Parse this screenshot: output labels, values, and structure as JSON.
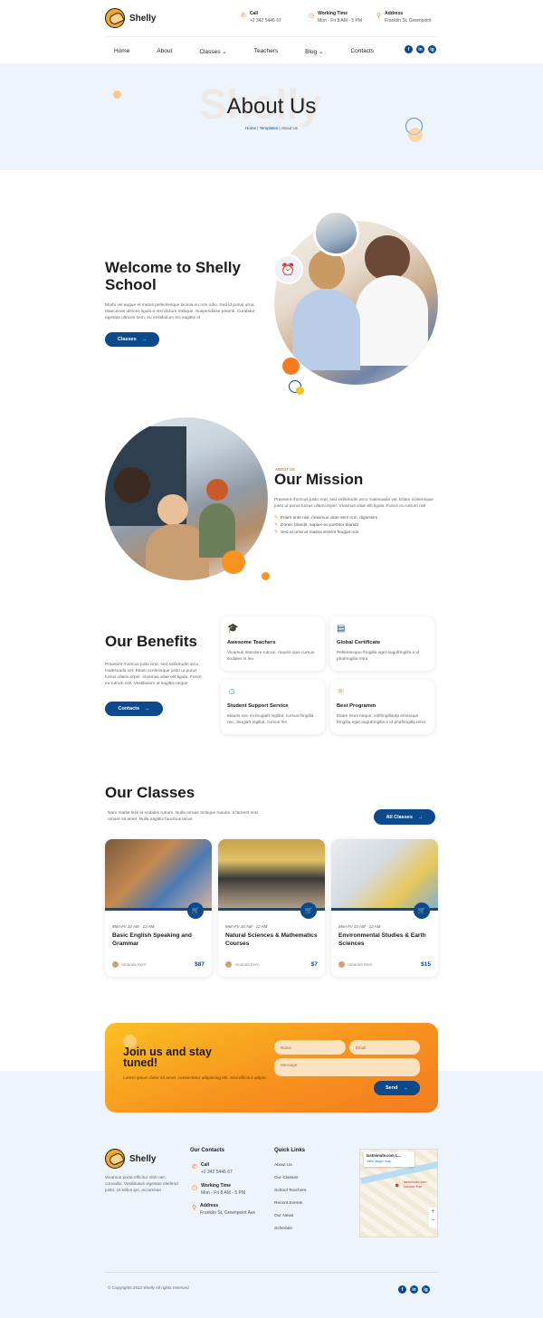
{
  "header": {
    "brand": "Shelly",
    "call_label": "Call",
    "call_value": "+2 342 5446 67",
    "hours_label": "Working Time",
    "hours_value": "Mon - Fri 8 AM - 5 PM",
    "address_label": "Address",
    "address_value": "Franklin St, Greenpoint"
  },
  "nav": {
    "items": [
      "Home",
      "About",
      "Classes",
      "Teachers",
      "Blog",
      "Contacts"
    ],
    "social": [
      "f",
      "in",
      "ig"
    ]
  },
  "hero": {
    "ghost": "Shelly",
    "title": "About Us",
    "crumb_home": "Home",
    "crumb_templates": "Templates",
    "crumb_current": "About Us"
  },
  "welcome": {
    "title": "Welcome to Shelly School",
    "text": "Morbi vel augue et metus pellentesque lacinia eu non odio. Sed id purus urna. Maecenas ultrices ligula a nisl dictum tristique. Suspendisse potenti. Curabitur egestas ultrices sem, eu vestibulum leo sagittis et",
    "button": "Classes"
  },
  "mission": {
    "eyebrow": "ABOUT US",
    "title": "Our Mission",
    "text": "Praesent rhoncus justo erat, sed sollicitudin arcu malesuada vel. Etiam scelerisque justo ut purus luctus ullamcorper. Vivamus vitae elit ligula. Fusce eu rutrum nisl",
    "points": [
      "Etiam ante nisl, maximus vitae sem non, dignissim",
      "Donec blandit, sapien eu porttitor blandit",
      "Sed at urna at massa viverra feugiat non"
    ]
  },
  "benefits": {
    "title": "Our Benefits",
    "text": "Praesent rhoncus justo erat, sed sollicitudin arcu malesuada vel. Etiam scelerisque justo ut purus luctus ullamcorper. Vivamus vitae elit ligula. Fusce eu rutrum nisl. Vestibulum at sagittis neque",
    "button": "Contacts",
    "cards": [
      {
        "title": "Awesome Teachers",
        "text": "Vivamus interdum rutrum, mauris quis cursus sodales is leo",
        "icon": "graduation-cap-icon"
      },
      {
        "title": "Global Certificate",
        "text": "Pellentesque fringilla eget augufringilla e id phafringilla retra",
        "icon": "certificate-icon"
      },
      {
        "title": "Student Support Service",
        "text": "Mauris nec mi feugiafr ingillat, cursus fringilla nec, feugiafr ingillat, cursus frin",
        "icon": "support-icon"
      },
      {
        "title": "Best Programm",
        "text": "Etiam risus neque, volfringillaufp emseque fringilla eget augufringilla e id phafringilla retra",
        "icon": "atom-icon"
      }
    ]
  },
  "classes": {
    "title": "Our Classes",
    "text": "Nam mattis felis id sodales rutrum. Nulla ornare tristique mauris, a laoreet erat ornare sit amet. Nulla sagittis faucibus lacus",
    "button": "All Classes",
    "items": [
      {
        "meta": "Mon-Fri    10 AM - 12 AM",
        "title": "Basic English Speaking and Grammar",
        "teacher": "Amanda Kern",
        "price": "$87"
      },
      {
        "meta": "Mon-Fri    10 AM - 12 AM",
        "title": "Natural Sciences & Mathematics Courses",
        "teacher": "Amanda Kern",
        "price": "$7"
      },
      {
        "meta": "Mon-Fri    10 AM - 12 AM",
        "title": "Environmental Studies & Earth Sciences",
        "teacher": "Amanda Kern",
        "price": "$15"
      }
    ]
  },
  "newsletter": {
    "title": "Join us and stay tuned!",
    "text": "Lorem ipsum dolor sit amet, consectetur adipiscing elit. Sed efficitur adipis.",
    "name_placeholder": "Name",
    "email_placeholder": "Email",
    "message_placeholder": "Message",
    "button": "Send"
  },
  "footer": {
    "brand": "Shelly",
    "about": "Vivamus porta efficitur nibh nec convallis. Vestibulum egestas eleifend justo. Ut tellus ips, accumsan",
    "contacts_title": "Our Contacts",
    "call_label": "Call",
    "call_value": "+2 342 5446 67",
    "hours_label": "Working Time",
    "hours_value": "Mon - Fri 8 AM - 5 PM",
    "address_label": "Address",
    "address_value": "Franklin St, Greenpoint Ave",
    "links_title": "Quick Links",
    "links": [
      "About Us",
      "Our Classes",
      "School Teachers",
      "Recent Events",
      "Our News",
      "Schedule"
    ],
    "map_title": "lastminute.com L...",
    "map_link": "View larger map",
    "map_pin": "lastminute.com London Eye",
    "copyright": "© Copyrights 2022 Shelly All rights reserved"
  },
  "colors": {
    "primary": "#0c4a8c",
    "accent": "#f47c20",
    "hero_bg": "#eef4fb"
  }
}
